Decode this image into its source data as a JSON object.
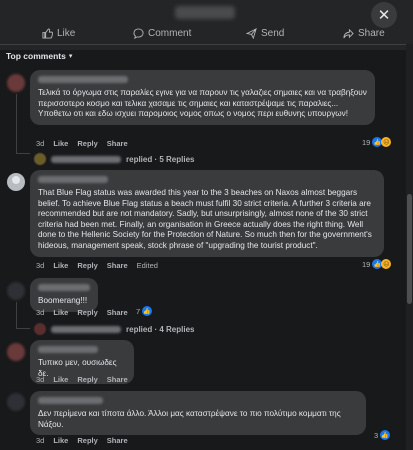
{
  "header": {
    "actions": [
      {
        "label": "Like",
        "icon": "like-icon"
      },
      {
        "label": "Comment",
        "icon": "comment-icon"
      },
      {
        "label": "Send",
        "icon": "send-icon"
      },
      {
        "label": "Share",
        "icon": "share-icon"
      }
    ],
    "close_icon": "close-icon"
  },
  "sort": {
    "label": "Top comments"
  },
  "comments": [
    {
      "text": "Τελικά το όργωμα στις παραλίες εγινε για να παρουν τις γαλαζιες σημαιες και να τραβηξουν περισσοτερο κοσμο και τελικα χασαμε τις σημαιες και καταστρέψαμε τις παραλιες... Υποθετω οτι και εδω ισχυει παρομοιος νομος οπως ο νομος περι ευθυνης υπουργων!",
      "time": "3d",
      "like": "Like",
      "reply": "Reply",
      "share": "Share",
      "reaction_count": "19",
      "replies_label": "replied · 5 Replies"
    },
    {
      "text": "That Blue Flag status was awarded this year to the 3 beaches on Naxos almost beggars belief. To achieve Blue Flag status a beach must fulfil 30 strict criteria. A further 3 criteria are recommended but are not mandatory. Sadly, but unsurprisingly, almost none of the 30 strict criteria had been met. Finally, an organisation in Greece actually does the right thing. Well done to the Hellenic Society for the Protection of Nature. So much then for the government's hideous, management speak, stock phrase of \"upgrading the tourist product\".",
      "time": "3d",
      "like": "Like",
      "reply": "Reply",
      "share": "Share",
      "edited": "Edited",
      "reaction_count": "19"
    },
    {
      "text": "Boomerang!!!",
      "time": "3d",
      "like": "Like",
      "reply": "Reply",
      "share": "Share",
      "reaction_count": "7",
      "replies_label": "replied · 4 Replies"
    },
    {
      "text": "Τυπικο μεν, ουσιωδες δε.",
      "time": "3d",
      "like": "Like",
      "reply": "Reply",
      "share": "Share"
    },
    {
      "text": "Δεν περίμενα και τίποτα άλλο. Άλλοι μας καταστρέψανε το πιο πολύτιμο κομματι της Νάξου.",
      "time": "3d",
      "like": "Like",
      "reply": "Reply",
      "share": "Share",
      "reaction_count": "3"
    }
  ],
  "colors": {
    "background": "#18191a",
    "bubble": "#3a3b3c",
    "accent": "#1877f2"
  }
}
